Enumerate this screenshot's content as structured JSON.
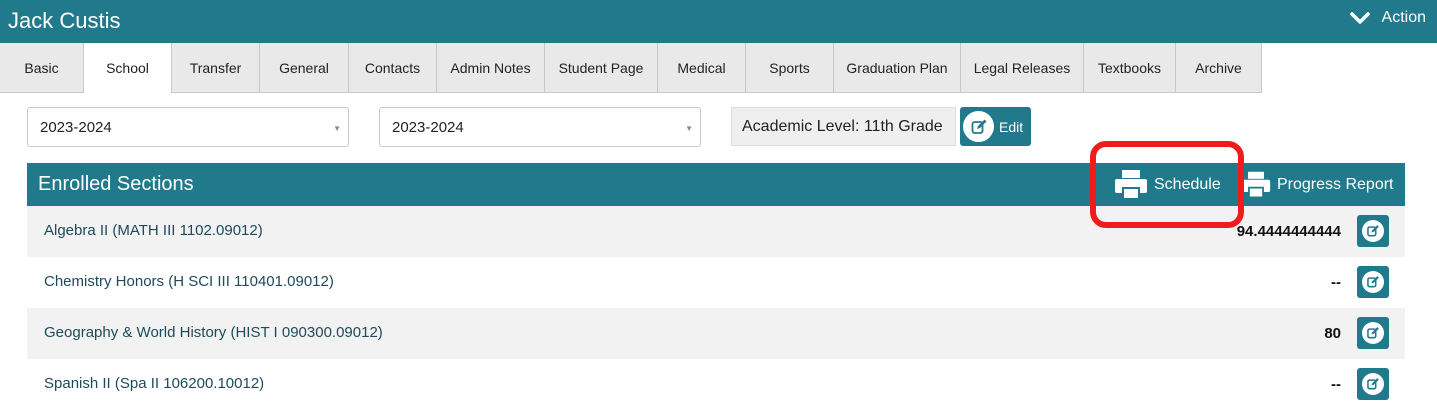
{
  "header": {
    "student_name": "Jack Custis",
    "action_label": "Action"
  },
  "tabs": [
    {
      "label": "Basic"
    },
    {
      "label": "School"
    },
    {
      "label": "Transfer"
    },
    {
      "label": "General"
    },
    {
      "label": "Contacts"
    },
    {
      "label": "Admin Notes"
    },
    {
      "label": "Student Page"
    },
    {
      "label": "Medical"
    },
    {
      "label": "Sports"
    },
    {
      "label": "Graduation Plan"
    },
    {
      "label": "Legal Releases"
    },
    {
      "label": "Textbooks"
    },
    {
      "label": "Archive"
    }
  ],
  "active_tab": "School",
  "filters": {
    "year_select_1": "2023-2024",
    "year_select_2": "2023-2024",
    "academic_level": "Academic Level: 11th Grade",
    "edit_label": "Edit"
  },
  "panel": {
    "title": "Enrolled Sections",
    "schedule_label": "Schedule",
    "progress_report_label": "Progress Report"
  },
  "sections": [
    {
      "name": "Algebra II (MATH III 1102.09012)",
      "grade": "94.4444444444"
    },
    {
      "name": "Chemistry Honors (H SCI III 110401.09012)",
      "grade": "--"
    },
    {
      "name": "Geography & World History (HIST I 090300.09012)",
      "grade": "80"
    },
    {
      "name": "Spanish II (Spa II 106200.10012)",
      "grade": "--"
    }
  ],
  "colors": {
    "primary": "#217a8c",
    "highlight": "#ee1c1c"
  }
}
